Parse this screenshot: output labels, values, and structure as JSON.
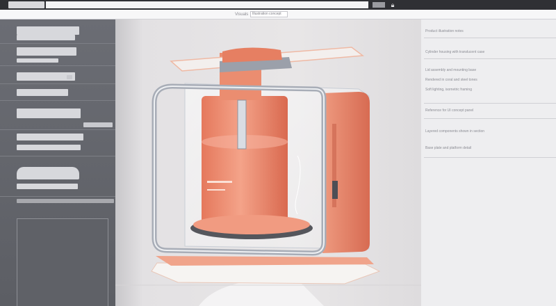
{
  "top_bar": {
    "address_text": "",
    "lock_icon": "lock-icon"
  },
  "toolbar": {
    "label": "Visuals",
    "field_value": "Illustration concept"
  },
  "inspector": {
    "heading": "Product illustration notes",
    "lines": [
      "Cylinder housing with translucent case",
      "Lid assembly and mounting base",
      "Rendered in coral and steel tones",
      "Soft lighting, isometric framing",
      "Reference for UI concept panel",
      "Layered components shown in section",
      "Base plate and platform detail"
    ]
  },
  "colors": {
    "accent": "#e8866a",
    "steel": "#a9adb6",
    "panel": "#eeeef0"
  }
}
